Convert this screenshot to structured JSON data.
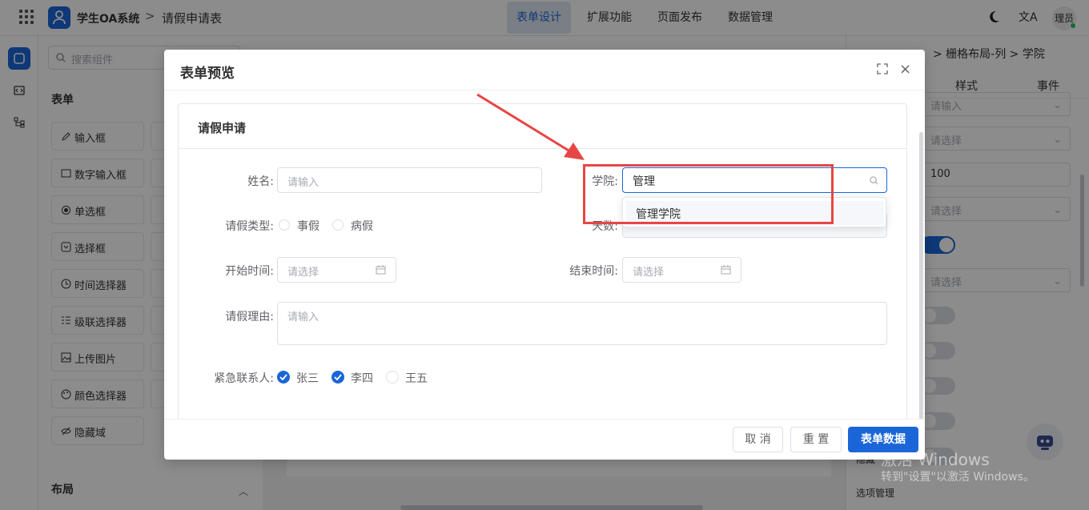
{
  "topbar": {
    "app_name": "学生OA系统",
    "separator": ">",
    "page_title": "请假申请表",
    "nav": [
      "表单设计",
      "扩展功能",
      "页面发布",
      "数据管理"
    ],
    "active_nav": "表单设计",
    "translate_icon": "文A",
    "user": "理员"
  },
  "components": {
    "search_placeholder": "搜索组件",
    "section_form": "表单",
    "items": [
      "输入框",
      "数字输入框",
      "单选框",
      "选择框",
      "时间选择器",
      "级联选择器",
      "上传图片",
      "颜色选择器",
      "隐藏域"
    ],
    "section_layout": "布局"
  },
  "props": {
    "breadcrumb": "> 栅格布局-列 > 学院",
    "tabs": [
      "样式",
      "事件"
    ],
    "fields": [
      "请输入",
      "请选择",
      "100",
      "请选择",
      "请选择"
    ],
    "options_label": "选项管理",
    "hidden_label": "隐藏"
  },
  "watermark": {
    "line1": "激活 Windows",
    "line2": "转到\"设置\"以激活 Windows。"
  },
  "dialog": {
    "title": "表单预览",
    "card_title": "请假申请",
    "fields": {
      "name_label": "姓名:",
      "name_placeholder": "请输入",
      "college_label": "学院:",
      "college_value": "管理",
      "leave_type_label": "请假类型:",
      "leave_types": [
        "事假",
        "病假"
      ],
      "days_label": "天数:",
      "start_label": "开始时间:",
      "start_placeholder": "请选择",
      "end_label": "结束时间:",
      "end_placeholder": "请选择",
      "reason_label": "请假理由:",
      "reason_placeholder": "请输入",
      "contact_label": "紧急联系人:",
      "contacts": [
        {
          "name": "张三",
          "checked": true
        },
        {
          "name": "李四",
          "checked": true
        },
        {
          "name": "王五",
          "checked": false
        }
      ]
    },
    "dropdown_option": "管理学院",
    "buttons": {
      "cancel": "取 消",
      "reset": "重 置",
      "submit": "表单数据"
    }
  },
  "colors": {
    "primary": "#1a66d9",
    "annotation": "#e84545"
  }
}
